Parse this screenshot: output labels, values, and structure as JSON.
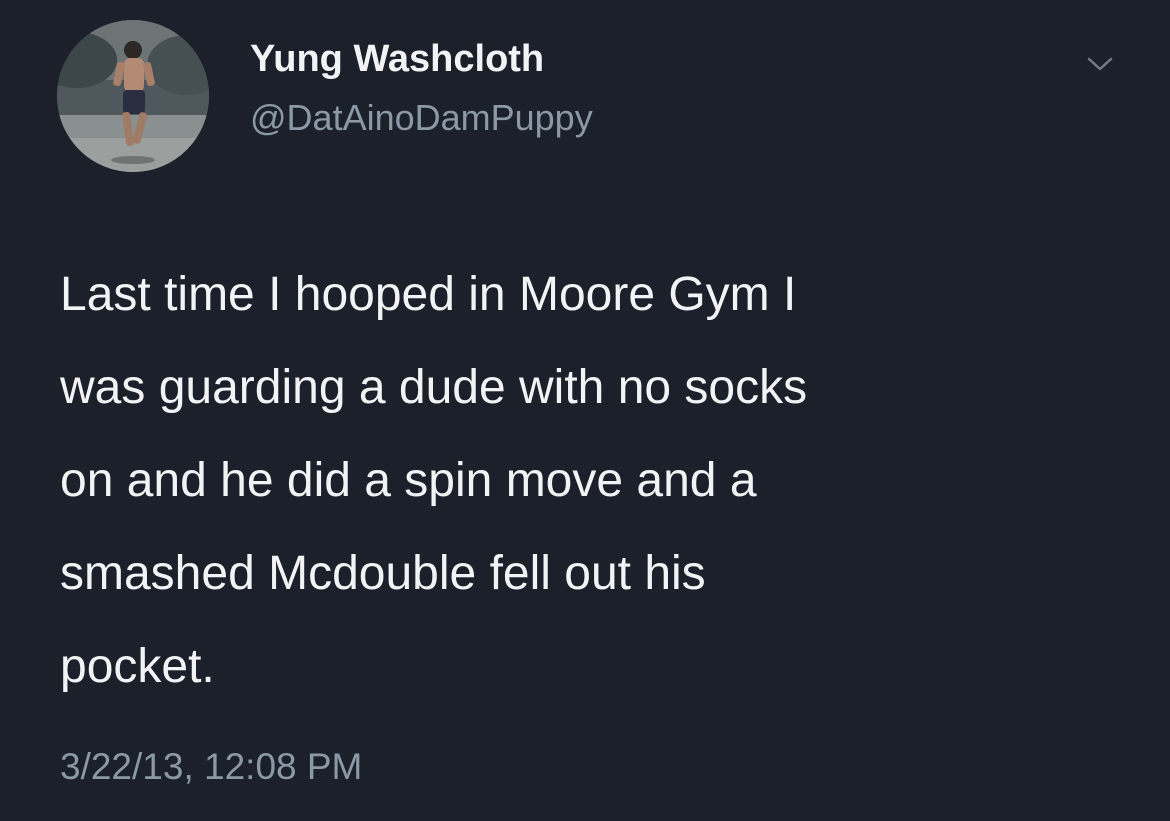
{
  "tweet": {
    "author": {
      "display_name": "Yung Washcloth",
      "handle": "@DatAinoDamPuppy"
    },
    "text_lines": [
      "Last time I hooped in Moore Gym I",
      "was guarding a dude with no socks",
      "on and he did a spin move and a",
      "smashed Mcdouble fell out his",
      "pocket."
    ],
    "timestamp": "3/22/13, 12:08 PM"
  },
  "icons": {
    "menu": "chevron-down-icon",
    "avatar": "avatar"
  },
  "colors": {
    "background": "#1b202a",
    "primary_text": "#f2f3f5",
    "secondary_text": "#8b98a5"
  }
}
